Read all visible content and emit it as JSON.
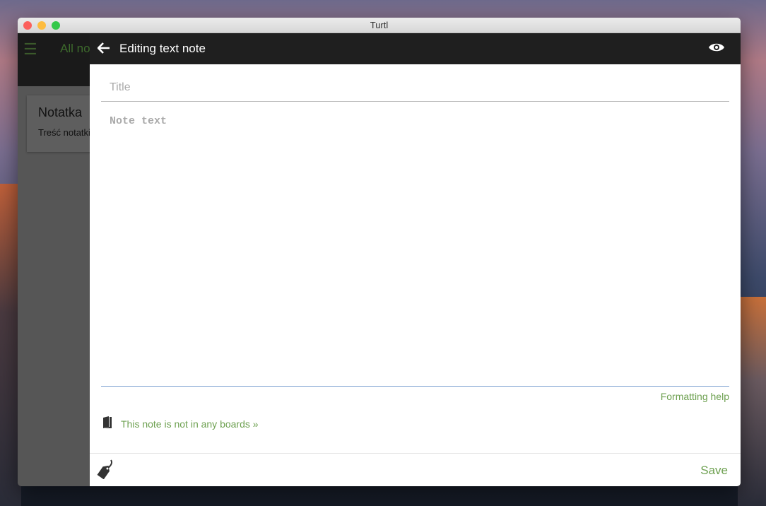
{
  "window": {
    "title": "Turtl"
  },
  "background_app": {
    "header_title": "All notes",
    "note_card": {
      "title": "Notatka",
      "body": "Treść notatki"
    }
  },
  "editor": {
    "header_title": "Editing text note",
    "title_placeholder": "Title",
    "body_placeholder": "Note text",
    "formatting_help": "Formatting help",
    "boards_link": "This note is not in any boards »",
    "save_label": "Save"
  },
  "colors": {
    "accent": "#6da050",
    "header": "#1f1f1f"
  }
}
